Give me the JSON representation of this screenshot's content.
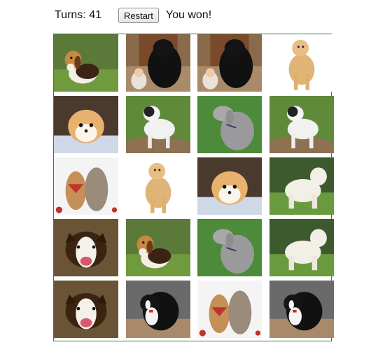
{
  "header": {
    "turns_label": "Turns: 41",
    "restart_label": "Restart",
    "status_text": "You won!"
  },
  "board": {
    "rows": 5,
    "cols": 4,
    "cards": [
      [
        "beagle-puppy",
        "newfoundland-with-baby",
        "newfoundland-with-baby",
        "golden-retriever-white"
      ],
      [
        "fluffy-puppy",
        "bulldog-mix",
        "weimaraner",
        "bulldog-mix"
      ],
      [
        "two-dogs-red-bandana",
        "golden-retriever-white",
        "fluffy-puppy",
        "white-poodle-mix"
      ],
      [
        "border-collie-face",
        "beagle-puppy",
        "weimaraner",
        "white-poodle-mix"
      ],
      [
        "border-collie-face",
        "border-collie-black-white",
        "two-dogs-red-bandana",
        "border-collie-black-white"
      ]
    ]
  }
}
